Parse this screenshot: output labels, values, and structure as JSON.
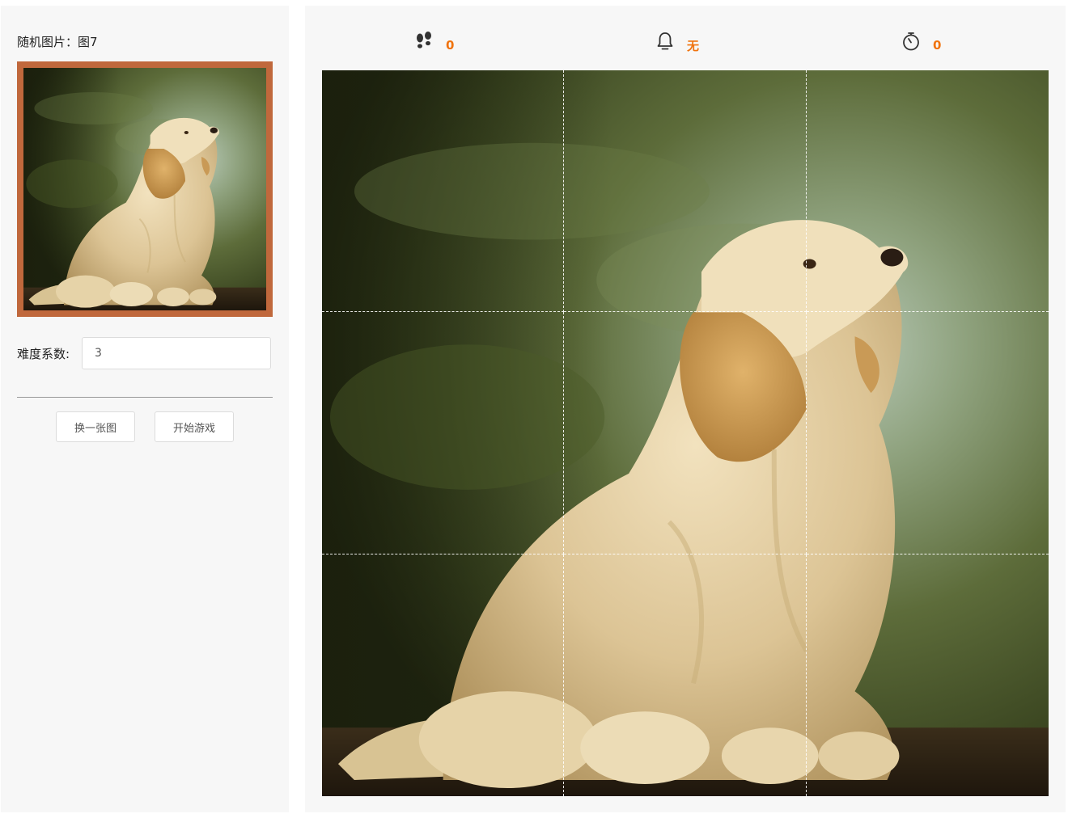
{
  "sidebar": {
    "random_label": "随机图片：图7",
    "preview_image": "puppy-photo",
    "difficulty_label": "难度系数:",
    "difficulty_value": "3",
    "buttons": {
      "change_label": "换一张图",
      "start_label": "开始游戏"
    }
  },
  "stats": {
    "steps": {
      "icon": "footsteps-icon",
      "value": "0"
    },
    "hint": {
      "icon": "bell-icon",
      "value": "无"
    },
    "timer": {
      "icon": "stopwatch-icon",
      "value": "0"
    }
  },
  "board": {
    "image": "puppy-photo",
    "grid_size": 3
  },
  "colors": {
    "accent": "#f0730e",
    "frame": "#c0683c",
    "panel": "#f7f7f7"
  }
}
